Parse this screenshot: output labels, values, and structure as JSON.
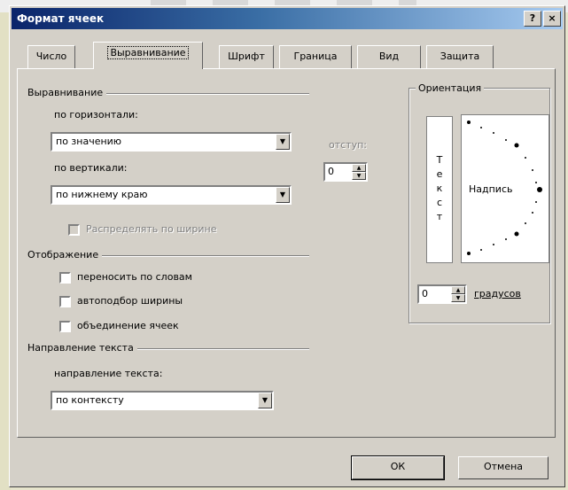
{
  "window": {
    "title": "Формат ячеек",
    "help_btn": "?",
    "close_btn": "×"
  },
  "tabs": [
    {
      "label": "Число"
    },
    {
      "label": "Выравнивание",
      "active": true
    },
    {
      "label": "Шрифт"
    },
    {
      "label": "Граница"
    },
    {
      "label": "Вид"
    },
    {
      "label": "Защита"
    }
  ],
  "alignment": {
    "group": "Выравнивание",
    "horizontal_label": "по горизонтали:",
    "horizontal_value": "по значению",
    "vertical_label": "по вертикали:",
    "vertical_value": "по нижнему краю",
    "indent_label": "отступ:",
    "indent_value": "0",
    "distribute_label": "Распределять по ширине"
  },
  "display": {
    "group": "Отображение",
    "wrap": "переносить по словам",
    "shrink": "автоподбор ширины",
    "merge": "объединение ячеек"
  },
  "direction": {
    "group": "Направление текста",
    "label": "направление текста:",
    "value": "по контексту"
  },
  "orientation": {
    "group": "Ориентация",
    "vertical_text": [
      "Т",
      "е",
      "к",
      "с",
      "т"
    ],
    "dial_label": "Надпись",
    "degrees_value": "0",
    "degrees_label": "градусов"
  },
  "buttons": {
    "ok": "ОК",
    "cancel": "Отмена"
  }
}
